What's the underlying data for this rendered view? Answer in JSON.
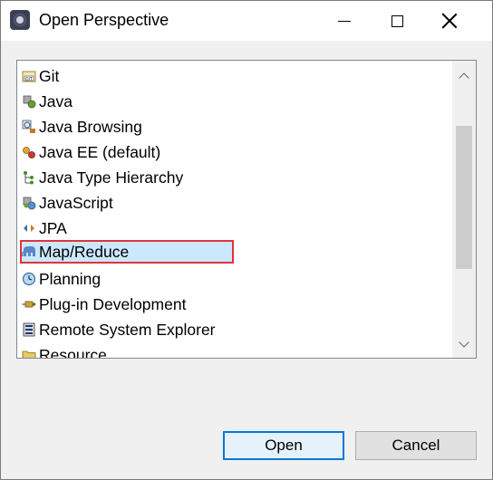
{
  "window": {
    "title": "Open Perspective"
  },
  "perspectives": [
    {
      "label": "Git",
      "icon": "git-icon",
      "selected": false
    },
    {
      "label": "Java",
      "icon": "java-perspective-icon",
      "selected": false
    },
    {
      "label": "Java Browsing",
      "icon": "java-browsing-icon",
      "selected": false
    },
    {
      "label": "Java EE (default)",
      "icon": "java-ee-icon",
      "selected": false
    },
    {
      "label": "Java Type Hierarchy",
      "icon": "type-hierarchy-icon",
      "selected": false
    },
    {
      "label": "JavaScript",
      "icon": "javascript-icon",
      "selected": false
    },
    {
      "label": "JPA",
      "icon": "jpa-icon",
      "selected": false
    },
    {
      "label": "Map/Reduce",
      "icon": "elephant-icon",
      "selected": true
    },
    {
      "label": "Planning",
      "icon": "clock-icon",
      "selected": false
    },
    {
      "label": "Plug-in Development",
      "icon": "plugin-icon",
      "selected": false
    },
    {
      "label": "Remote System Explorer",
      "icon": "remote-system-icon",
      "selected": false
    },
    {
      "label": "Resource",
      "icon": "resource-folder-icon",
      "selected": false
    }
  ],
  "buttons": {
    "open_label": "Open",
    "cancel_label": "Cancel"
  },
  "colors": {
    "selection_bg": "#cce8ff",
    "highlight_border": "#e0333a",
    "default_button_border": "#0078d7"
  }
}
